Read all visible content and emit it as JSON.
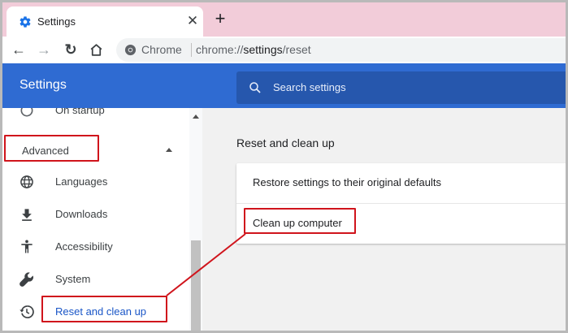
{
  "tab": {
    "title": "Settings",
    "close_glyph": "✕",
    "new_tab_glyph": "+"
  },
  "toolbar": {
    "back_glyph": "←",
    "forward_glyph": "→",
    "reload_glyph": "↻",
    "site_label": "Chrome",
    "url_prefix": "chrome://",
    "url_host": "settings",
    "url_path": "/reset"
  },
  "header": {
    "title": "Settings",
    "search_placeholder": "Search settings"
  },
  "sidebar": {
    "partial_item": "On startup",
    "advanced_label": "Advanced",
    "items": [
      {
        "label": "Languages",
        "icon": "globe-icon"
      },
      {
        "label": "Downloads",
        "icon": "download-icon"
      },
      {
        "label": "Accessibility",
        "icon": "accessibility-icon"
      },
      {
        "label": "System",
        "icon": "wrench-icon"
      },
      {
        "label": "Reset and clean up",
        "icon": "history-icon",
        "active": true
      }
    ]
  },
  "main": {
    "section_title": "Reset and clean up",
    "rows": [
      {
        "label": "Restore settings to their original defaults"
      },
      {
        "label": "Clean up computer"
      }
    ]
  },
  "colors": {
    "header_bg": "#2f6bd2",
    "tabstrip_bg": "#f2ccd9",
    "annotation_red": "#d0141c",
    "active_blue": "#1a56c7"
  }
}
